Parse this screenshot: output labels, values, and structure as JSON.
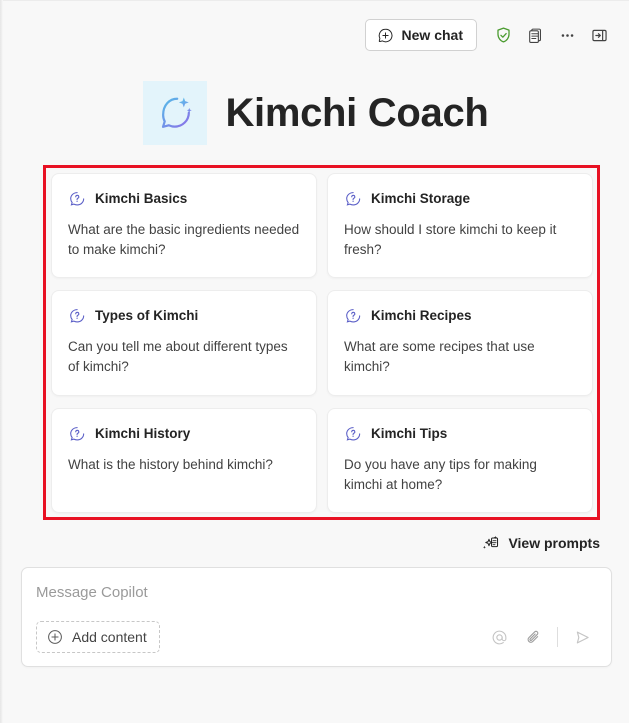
{
  "toolbar": {
    "new_chat_label": "New chat",
    "new_chat_icon": "chat-add-icon",
    "icons": [
      {
        "name": "shield-check-icon",
        "label": "Protected",
        "color": "#4a9b2f"
      },
      {
        "name": "notes-icon",
        "label": "Notes",
        "color": "#424242"
      },
      {
        "name": "more-options-icon",
        "label": "More options",
        "color": "#424242"
      },
      {
        "name": "collapse-panel-icon",
        "label": "Collapse panel",
        "color": "#424242"
      }
    ]
  },
  "hero": {
    "title": "Kimchi Coach",
    "icon": "chat-sparkle-icon",
    "icon_bg": "#e3f4fb",
    "icon_gradient_start": "#4fc3e8",
    "icon_gradient_end": "#8b6fe8"
  },
  "prompts": {
    "highlight_color": "#e81123",
    "card_icon": "chat-question-icon",
    "card_icon_color": "#5b5fc7",
    "cards": [
      {
        "title": "Kimchi Basics",
        "body": "What are the basic ingredients needed to make kimchi?"
      },
      {
        "title": "Kimchi Storage",
        "body": "How should I store kimchi to keep it fresh?"
      },
      {
        "title": "Types of Kimchi",
        "body": "Can you tell me about different types of kimchi?"
      },
      {
        "title": "Kimchi Recipes",
        "body": "What are some recipes that use kimchi?"
      },
      {
        "title": "Kimchi History",
        "body": "What is the history behind kimchi?"
      },
      {
        "title": "Kimchi Tips",
        "body": "Do you have any tips for making kimchi at home?"
      }
    ]
  },
  "view_prompts": {
    "label": "View prompts",
    "icon": "prompt-sparkle-icon"
  },
  "composer": {
    "placeholder": "Message Copilot",
    "value": "",
    "add_content_label": "Add content",
    "add_content_icon": "plus-circle-icon",
    "actions": [
      {
        "name": "mention-icon",
        "label": "Mention"
      },
      {
        "name": "attach-icon",
        "label": "Attach file"
      },
      {
        "name": "send-icon",
        "label": "Send"
      }
    ]
  }
}
